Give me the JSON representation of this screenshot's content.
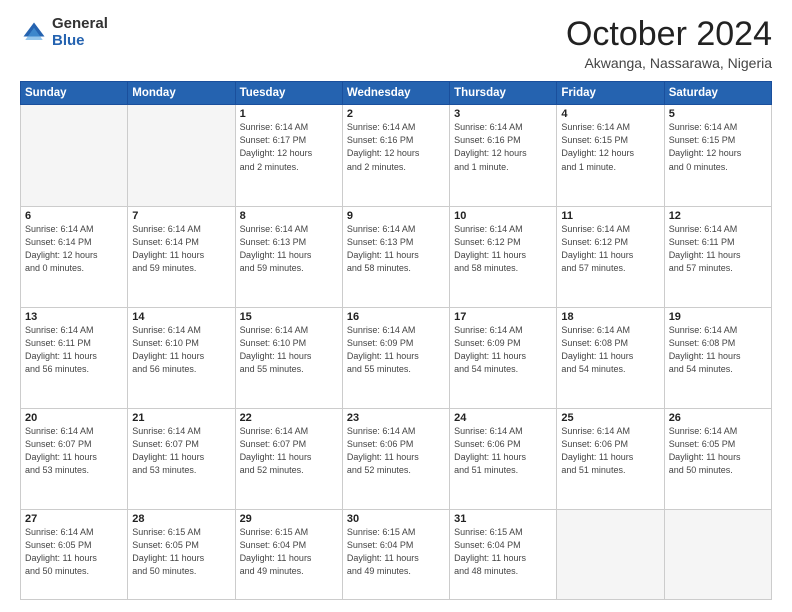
{
  "logo": {
    "general": "General",
    "blue": "Blue"
  },
  "header": {
    "month": "October 2024",
    "location": "Akwanga, Nassarawa, Nigeria"
  },
  "days_of_week": [
    "Sunday",
    "Monday",
    "Tuesday",
    "Wednesday",
    "Thursday",
    "Friday",
    "Saturday"
  ],
  "weeks": [
    [
      {
        "day": "",
        "info": ""
      },
      {
        "day": "",
        "info": ""
      },
      {
        "day": "1",
        "info": "Sunrise: 6:14 AM\nSunset: 6:17 PM\nDaylight: 12 hours\nand 2 minutes."
      },
      {
        "day": "2",
        "info": "Sunrise: 6:14 AM\nSunset: 6:16 PM\nDaylight: 12 hours\nand 2 minutes."
      },
      {
        "day": "3",
        "info": "Sunrise: 6:14 AM\nSunset: 6:16 PM\nDaylight: 12 hours\nand 1 minute."
      },
      {
        "day": "4",
        "info": "Sunrise: 6:14 AM\nSunset: 6:15 PM\nDaylight: 12 hours\nand 1 minute."
      },
      {
        "day": "5",
        "info": "Sunrise: 6:14 AM\nSunset: 6:15 PM\nDaylight: 12 hours\nand 0 minutes."
      }
    ],
    [
      {
        "day": "6",
        "info": "Sunrise: 6:14 AM\nSunset: 6:14 PM\nDaylight: 12 hours\nand 0 minutes."
      },
      {
        "day": "7",
        "info": "Sunrise: 6:14 AM\nSunset: 6:14 PM\nDaylight: 11 hours\nand 59 minutes."
      },
      {
        "day": "8",
        "info": "Sunrise: 6:14 AM\nSunset: 6:13 PM\nDaylight: 11 hours\nand 59 minutes."
      },
      {
        "day": "9",
        "info": "Sunrise: 6:14 AM\nSunset: 6:13 PM\nDaylight: 11 hours\nand 58 minutes."
      },
      {
        "day": "10",
        "info": "Sunrise: 6:14 AM\nSunset: 6:12 PM\nDaylight: 11 hours\nand 58 minutes."
      },
      {
        "day": "11",
        "info": "Sunrise: 6:14 AM\nSunset: 6:12 PM\nDaylight: 11 hours\nand 57 minutes."
      },
      {
        "day": "12",
        "info": "Sunrise: 6:14 AM\nSunset: 6:11 PM\nDaylight: 11 hours\nand 57 minutes."
      }
    ],
    [
      {
        "day": "13",
        "info": "Sunrise: 6:14 AM\nSunset: 6:11 PM\nDaylight: 11 hours\nand 56 minutes."
      },
      {
        "day": "14",
        "info": "Sunrise: 6:14 AM\nSunset: 6:10 PM\nDaylight: 11 hours\nand 56 minutes."
      },
      {
        "day": "15",
        "info": "Sunrise: 6:14 AM\nSunset: 6:10 PM\nDaylight: 11 hours\nand 55 minutes."
      },
      {
        "day": "16",
        "info": "Sunrise: 6:14 AM\nSunset: 6:09 PM\nDaylight: 11 hours\nand 55 minutes."
      },
      {
        "day": "17",
        "info": "Sunrise: 6:14 AM\nSunset: 6:09 PM\nDaylight: 11 hours\nand 54 minutes."
      },
      {
        "day": "18",
        "info": "Sunrise: 6:14 AM\nSunset: 6:08 PM\nDaylight: 11 hours\nand 54 minutes."
      },
      {
        "day": "19",
        "info": "Sunrise: 6:14 AM\nSunset: 6:08 PM\nDaylight: 11 hours\nand 54 minutes."
      }
    ],
    [
      {
        "day": "20",
        "info": "Sunrise: 6:14 AM\nSunset: 6:07 PM\nDaylight: 11 hours\nand 53 minutes."
      },
      {
        "day": "21",
        "info": "Sunrise: 6:14 AM\nSunset: 6:07 PM\nDaylight: 11 hours\nand 53 minutes."
      },
      {
        "day": "22",
        "info": "Sunrise: 6:14 AM\nSunset: 6:07 PM\nDaylight: 11 hours\nand 52 minutes."
      },
      {
        "day": "23",
        "info": "Sunrise: 6:14 AM\nSunset: 6:06 PM\nDaylight: 11 hours\nand 52 minutes."
      },
      {
        "day": "24",
        "info": "Sunrise: 6:14 AM\nSunset: 6:06 PM\nDaylight: 11 hours\nand 51 minutes."
      },
      {
        "day": "25",
        "info": "Sunrise: 6:14 AM\nSunset: 6:06 PM\nDaylight: 11 hours\nand 51 minutes."
      },
      {
        "day": "26",
        "info": "Sunrise: 6:14 AM\nSunset: 6:05 PM\nDaylight: 11 hours\nand 50 minutes."
      }
    ],
    [
      {
        "day": "27",
        "info": "Sunrise: 6:14 AM\nSunset: 6:05 PM\nDaylight: 11 hours\nand 50 minutes."
      },
      {
        "day": "28",
        "info": "Sunrise: 6:15 AM\nSunset: 6:05 PM\nDaylight: 11 hours\nand 50 minutes."
      },
      {
        "day": "29",
        "info": "Sunrise: 6:15 AM\nSunset: 6:04 PM\nDaylight: 11 hours\nand 49 minutes."
      },
      {
        "day": "30",
        "info": "Sunrise: 6:15 AM\nSunset: 6:04 PM\nDaylight: 11 hours\nand 49 minutes."
      },
      {
        "day": "31",
        "info": "Sunrise: 6:15 AM\nSunset: 6:04 PM\nDaylight: 11 hours\nand 48 minutes."
      },
      {
        "day": "",
        "info": ""
      },
      {
        "day": "",
        "info": ""
      }
    ]
  ]
}
